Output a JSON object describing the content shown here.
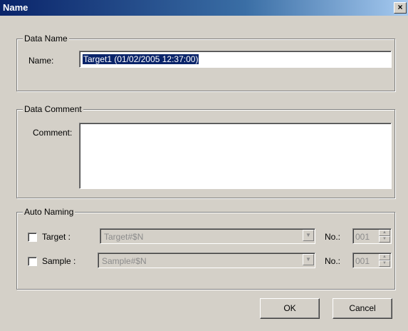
{
  "window": {
    "title": "Name",
    "close_glyph": "×"
  },
  "data_name": {
    "group_label": "Data Name",
    "name_label": "Name:",
    "name_value": "Target1 (01/02/2005 12:37:00)"
  },
  "data_comment": {
    "group_label": "Data Comment",
    "comment_label": "Comment:",
    "comment_value": ""
  },
  "auto_naming": {
    "group_label": "Auto Naming",
    "target": {
      "label": "Target :",
      "checked": false,
      "pattern": "Target#$N",
      "no_label": "No.:",
      "no_value": "001"
    },
    "sample": {
      "label": "Sample :",
      "checked": false,
      "pattern": "Sample#$N",
      "no_label": "No.:",
      "no_value": "001"
    }
  },
  "buttons": {
    "ok": "OK",
    "cancel": "Cancel"
  },
  "icons": {
    "dropdown": "chevron-down-icon",
    "spin_up": "chevron-up-icon",
    "spin_down": "chevron-down-icon"
  }
}
